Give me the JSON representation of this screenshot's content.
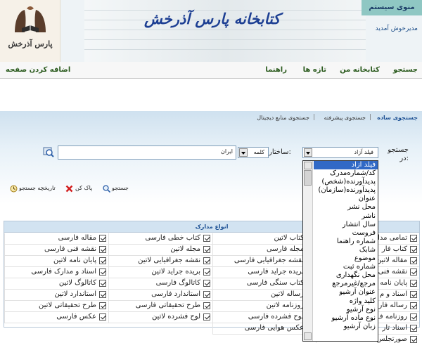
{
  "header": {
    "logo_text": "پارس آذرخش",
    "site_title": "کتابخانه پارس آذرخش",
    "system_menu": "منوی سیستم",
    "welcome": "مدیرخوش آمدید"
  },
  "nav": {
    "items": [
      "جستجو",
      "کتابخانه من",
      "تازه ها",
      "راهنما"
    ],
    "add_page": "اضافه کردن صفحه"
  },
  "search": {
    "tabs": [
      "جستجوی ساده",
      "جستجوی پیشرفته",
      "جستجوی منابع دیجیتال"
    ],
    "search_label": "جستجو در:",
    "field_value": "فیلد آزاد",
    "structure_label": "ساختار:",
    "structure_value": "کلمه",
    "query_value": "ایران",
    "buttons": {
      "search": "جستجو",
      "clear": "پاک کن",
      "history": "تاریخچه جستجو"
    }
  },
  "doc_types": {
    "title": "انواع مدارک",
    "col1": [
      "تمامی مدا",
      "کتاب فار",
      "مقاله لاتین",
      "نقشه فنی",
      "پایان نامه",
      "اسناد و م",
      "رساله فار",
      "روزنامه ف",
      "اسناد تار",
      "صورتجلس"
    ],
    "col2": [
      "کتاب لاتین",
      "مجله فارسی",
      "نقشه جغرافیایی فارسی",
      "بریده جراید فارسی",
      "کتاب سنگی فارسی",
      "رساله لاتین",
      "روزنامه لاتین",
      "لوح فشرده فارسی",
      "عکس هوایی فارسی"
    ],
    "col3": [
      "کتاب خطی فارسی",
      "مجله لاتین",
      "نقشه جغرافیایی لاتین",
      "بریده جراید لاتین",
      "کاتالوگ فارسی",
      "استاندارد فارسی",
      "طرح تحقیقاتی فارسی",
      "لوح فشرده لاتین"
    ],
    "col4": [
      "مقاله فارسی",
      "نقشه فنی فارسی",
      "پایان نامه لاتین",
      "اسناد و مدارک فارسی",
      "کاتالوگ لاتین",
      "استاندارد لاتین",
      "طرح تحقیقاتی لاتین",
      "عکس فارسی"
    ]
  },
  "field_options": [
    "فیلد آزاد",
    "کد/شماره‌مدرک",
    "پدیدآورنده(شخص)",
    "پدیدآورنده(سازمان)",
    "عنوان",
    "محل نشر",
    "ناشر",
    "سال انتشار",
    "فروست",
    "شماره راهنما",
    "شابک",
    "موضوع",
    "شماره ثبت",
    "محل نگهداری",
    "مرجع/غیرمرجع",
    "عنوان آرشیو",
    "کلید واژه",
    "نوع آرشیو",
    "نوع ماده آرشیو",
    "زبان آرشیو"
  ]
}
